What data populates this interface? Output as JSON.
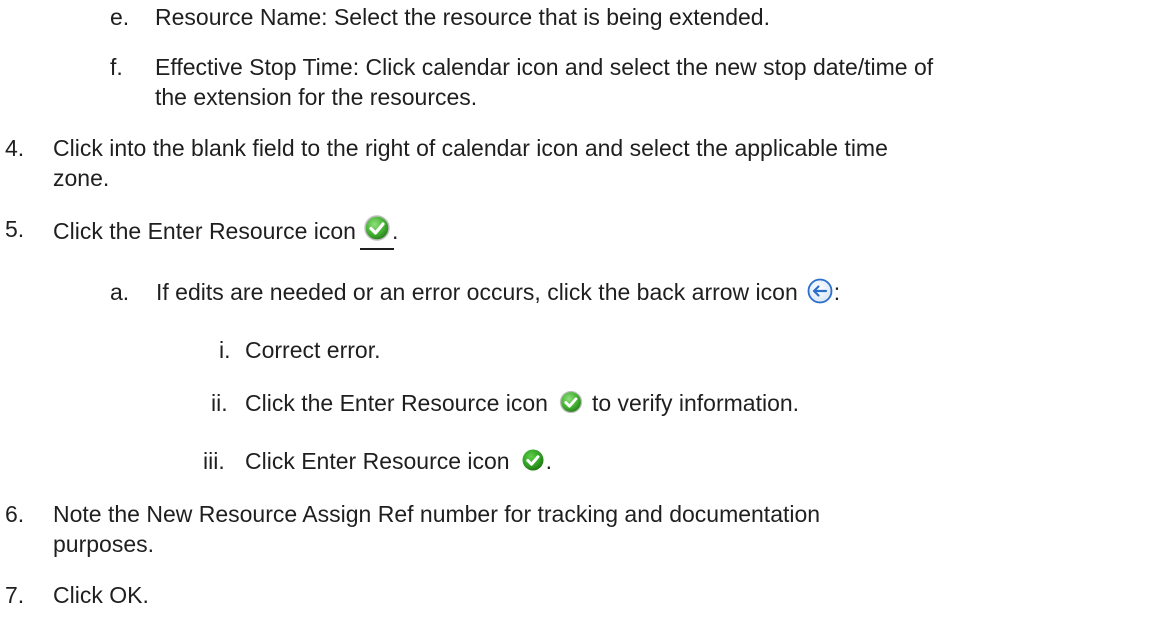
{
  "steps": {
    "e": {
      "marker": "e.",
      "text": "Resource Name:  Select the resource that is being extended."
    },
    "f": {
      "marker": "f.",
      "line1": "Effective Stop Time:  Click calendar icon and select the new stop date/time of",
      "line2": "the extension for the resources."
    },
    "s4": {
      "marker": "4.",
      "line1": "Click into the blank field to the right of calendar icon and select the applicable time",
      "line2": "zone."
    },
    "s5": {
      "marker": "5.",
      "text": "Click the Enter Resource icon",
      "after": "."
    },
    "a": {
      "marker": "a.",
      "text": "If edits are needed or an error occurs, click the back arrow icon",
      "after": ":"
    },
    "i": {
      "marker": "i.",
      "text": "Correct error."
    },
    "ii": {
      "marker": "ii.",
      "text": "Click the Enter Resource icon",
      "after": "to verify information."
    },
    "iii": {
      "marker": "iii.",
      "text": "Click Enter Resource icon",
      "after": "."
    },
    "s6": {
      "marker": "6.",
      "line1": "Note the New Resource Assign Ref number for tracking and documentation",
      "line2": "purposes."
    },
    "s7": {
      "marker": "7.",
      "text": "Click OK."
    }
  },
  "colors": {
    "text": "#1f1f1f",
    "check_green": "#3caa2c",
    "arrow_blue": "#2a6fc9"
  },
  "icons": {
    "enter_resource": "green-check-circle-icon",
    "back_arrow": "back-arrow-icon"
  }
}
